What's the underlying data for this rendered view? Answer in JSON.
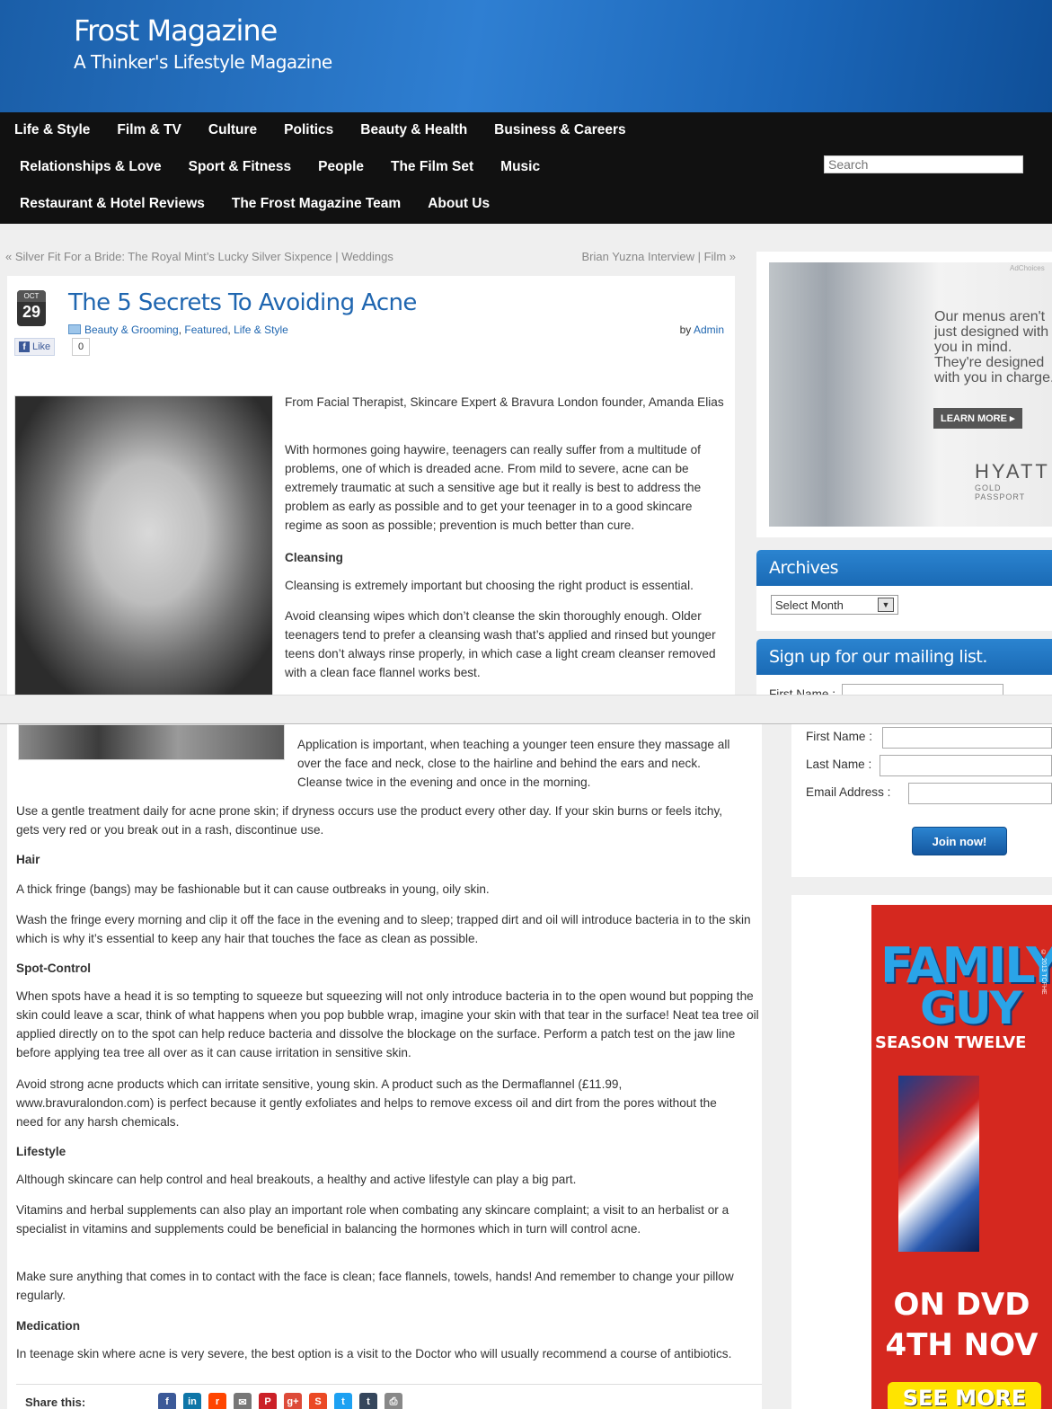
{
  "header": {
    "title": "Frost Magazine",
    "tagline": "A Thinker's Lifestyle Magazine"
  },
  "nav": {
    "row1": [
      "Life & Style",
      "Film & TV",
      "Culture",
      "Politics",
      "Beauty & Health",
      "Business & Careers"
    ],
    "row2": [
      "Relationships & Love",
      "Sport & Fitness",
      "People",
      "The Film Set",
      "Music"
    ],
    "row3": [
      "Restaurant & Hotel Reviews",
      "The Frost Magazine Team",
      "About Us"
    ],
    "search_placeholder": "Search"
  },
  "post_nav": {
    "prev": "« Silver Fit For a Bride: The Royal Mint’s Lucky Silver Sixpence | Weddings",
    "next": "Brian Yuzna Interview | Film »"
  },
  "post": {
    "date_month": "OCT",
    "date_day": "29",
    "title": "The 5 Secrets To Avoiding Acne",
    "categories": [
      {
        "label": "Beauty & Grooming",
        "sep": ", "
      },
      {
        "label": "Featured",
        "sep": ", "
      },
      {
        "label": "Life & Style",
        "sep": ""
      }
    ],
    "author_prefix": "by",
    "author": "Admin",
    "like_label": "Like",
    "like_count": "0",
    "paragraphs": {
      "intro": "From Facial Therapist, Skincare Expert & Bravura London founder, Amanda Elias",
      "p1": "With hormones going haywire, teenagers can really suffer from a multitude of problems, one of which is dreaded acne. From mild to severe, acne can be extremely traumatic at such a sensitive age but it really is best to address the problem as early as possible and to get your teenager in to a good skincare regime as soon as possible; prevention is much better than cure.",
      "h_cleansing": "Cleansing",
      "p2": "Cleansing is extremely important but choosing the right product is essential.",
      "p3": "Avoid cleansing wipes which don’t cleanse the skin thoroughly enough. Older teenagers tend to prefer a cleansing wash that’s applied and rinsed but younger teens don’t always rinse properly, in which case a light cream cleanser removed with a clean face flannel works best.",
      "p4": "Application is important, when teaching a younger teen ensure they massage all over the face and neck, close to the hairline and behind the ears and neck. Cleanse twice in the evening and once in the morning.",
      "p5": "Use a gentle treatment daily for acne prone skin; if dryness occurs use the product every other day. If your skin burns or feels itchy, gets very red or you break out in a rash, discontinue use.",
      "h_hair": "Hair",
      "p6": "A thick fringe (bangs) may be fashionable but it can cause outbreaks in young, oily skin.",
      "p7": "Wash the fringe every morning and clip it off the face in the evening and to sleep; trapped dirt and oil will introduce bacteria in to the skin which is why it’s essential to keep any hair that touches the face as clean as possible.",
      "h_spot": "Spot-Control",
      "p8": "When spots have a head it is so tempting to squeeze but squeezing will not only introduce bacteria in to the open wound but popping the skin could leave a scar, think of what happens when you pop bubble wrap, imagine your skin with that tear in the surface! Neat tea tree oil applied directly on to the spot can help reduce bacteria and dissolve the blockage on the surface. Perform a patch test on the jaw line before applying tea tree all over as it can cause irritation in sensitive skin.",
      "p9": "Avoid strong acne products which can irritate sensitive, young skin. A product such as the Dermaflannel (£11.99, www.bravuralondon.com) is perfect because it gently exfoliates and helps to remove excess oil and dirt from the pores without the need for any harsh chemicals.",
      "h_lifestyle": "Lifestyle",
      "p10": "Although skincare can help control and heal breakouts, a healthy and active lifestyle can play a big part.",
      "p11": "Vitamins and herbal supplements can also play an important role when combating any skincare complaint; a visit to an herbalist or a specialist in vitamins and supplements could be beneficial in balancing the hormones which in turn will control acne.",
      "p12": "Make sure anything that comes in to contact with the face is clean; face flannels, towels, hands! And remember to change your pillow regularly.",
      "h_medication": "Medication",
      "p13": "In teenage skin where acne is very severe, the best option is a visit to the Doctor who will usually recommend a course of antibiotics."
    },
    "share_label": "Share this:",
    "share_icons": [
      {
        "name": "facebook-icon",
        "color": "#3b5998",
        "glyph": "f"
      },
      {
        "name": "linkedin-icon",
        "color": "#0e76a8",
        "glyph": "in"
      },
      {
        "name": "reddit-icon",
        "color": "#ff4500",
        "glyph": "r"
      },
      {
        "name": "email-icon",
        "color": "#777777",
        "glyph": "✉"
      },
      {
        "name": "pinterest-icon",
        "color": "#cb2027",
        "glyph": "P"
      },
      {
        "name": "googleplus-icon",
        "color": "#dd4b39",
        "glyph": "g+"
      },
      {
        "name": "stumbleupon-icon",
        "color": "#eb4924",
        "glyph": "S"
      },
      {
        "name": "twitter-icon",
        "color": "#1da1f2",
        "glyph": "t"
      },
      {
        "name": "tumblr-icon",
        "color": "#35465c",
        "glyph": "t"
      },
      {
        "name": "print-icon",
        "color": "#888888",
        "glyph": "⎙"
      }
    ]
  },
  "sidebar": {
    "ad": {
      "choices": "AdChoices",
      "text": "Our menus aren't just designed with you in mind. They're designed with you in charge.",
      "button": "LEARN MORE ▸",
      "brand": "HYATT",
      "brand_sub": "GOLD PASSPORT"
    },
    "archives": {
      "title": "Archives",
      "select_value": "Select Month"
    },
    "mailing": {
      "title": "Sign up for our mailing list.",
      "first_name": "First Name :",
      "last_name": "Last Name :",
      "email": "Email Address :",
      "join": "Join now!"
    },
    "dvd_ad": {
      "logo_line1": "FAMILY",
      "logo_line2": "GUY",
      "season": "SEASON TWELVE",
      "tm": "© 2013 TCFHE",
      "line1": "ON DVD",
      "line2": "4TH NOV",
      "cta": "SEE MORE"
    }
  },
  "colors": {
    "header_blue": "#1f6cbf",
    "nav_bg": "#111111",
    "link": "#1f66b0",
    "dvd_red": "#d5281f",
    "dvd_yellow": "#ffe400"
  }
}
